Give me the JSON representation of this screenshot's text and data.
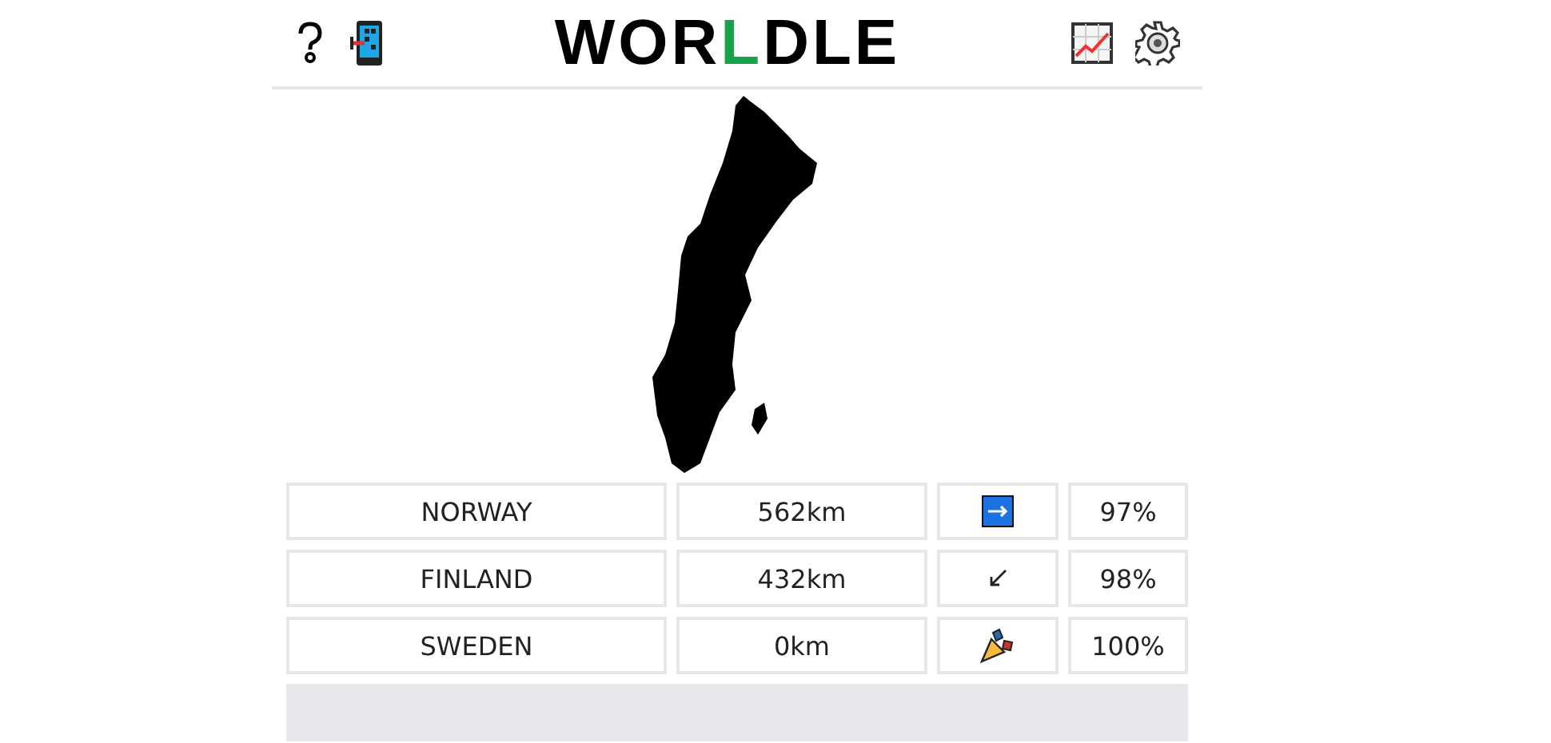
{
  "header": {
    "title": [
      {
        "letter": "W",
        "color": "#000000"
      },
      {
        "letter": "O",
        "color": "#000000"
      },
      {
        "letter": "R",
        "color": "#000000"
      },
      {
        "letter": "L",
        "color": "#16a34a"
      },
      {
        "letter": "D",
        "color": "#000000"
      },
      {
        "letter": "L",
        "color": "#000000"
      },
      {
        "letter": "E",
        "color": "#000000"
      }
    ]
  },
  "guesses": [
    {
      "country": "NORWAY",
      "distance": "562km",
      "kind": "east",
      "proximity": "97%"
    },
    {
      "country": "FINLAND",
      "distance": "432km",
      "kind": "southwest",
      "proximity": "98%"
    },
    {
      "country": "SWEDEN",
      "distance": "0km",
      "kind": "found",
      "proximity": "100%"
    }
  ]
}
